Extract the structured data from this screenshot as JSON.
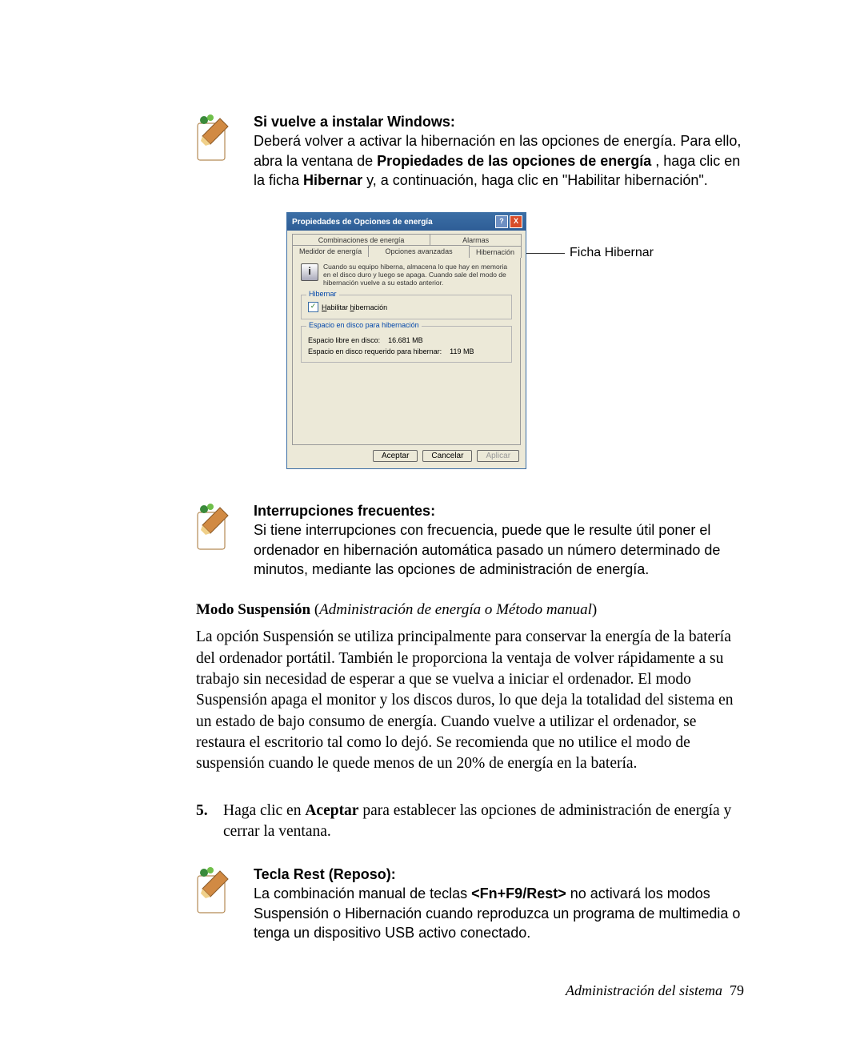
{
  "note1": {
    "title": "Si vuelve a instalar Windows:",
    "t1": "Deberá volver a activar la hibernación en las opciones de energía. Para ello, abra la ventana de ",
    "b1": "Propiedades de las opciones de energía",
    "t2": " , haga clic en la ficha ",
    "b2": "Hibernar",
    "t3": " y, a continuación, haga clic en \"Habilitar hibernación\"."
  },
  "dialog": {
    "title": "Propiedades de Opciones de energía",
    "help_glyph": "?",
    "close_glyph": "X",
    "tabs_row1": {
      "t1": "Combinaciones de energía",
      "t2": "Alarmas"
    },
    "tabs_row2": {
      "t1": "Medidor de energía",
      "t2": "Opciones avanzadas",
      "t3": "Hibernación"
    },
    "info_icon": "i",
    "info": "Cuando su equipo hiberna, almacena lo que hay en memoria en el disco duro y luego se apaga. Cuando sale del modo de hibernación vuelve a su estado anterior.",
    "group1": {
      "legend": "Hibernar",
      "check_glyph": "✓",
      "checkbox": "Habilitar hibernación"
    },
    "group2": {
      "legend": "Espacio en disco para hibernación",
      "free_label": "Espacio libre en disco:",
      "free_value": "16.681 MB",
      "req_label": "Espacio en disco requerido para hibernar:",
      "req_value": "119 MB"
    },
    "accept": "Aceptar",
    "cancel": "Cancelar",
    "apply": "Aplicar"
  },
  "callout": "Ficha Hibernar",
  "note2": {
    "title": "Interrupciones frecuentes:",
    "body": "Si tiene interrupciones con frecuencia, puede que le resulte útil poner el ordenador en hibernación automática pasado un número determinado de minutos, mediante las opciones de administración de energía."
  },
  "heading": {
    "bold": "Modo Suspensión",
    "paren_open": "(",
    "italic": "Administración de energía o Método manual",
    "paren_close": ")"
  },
  "body_para": "La opción Suspensión se utiliza principalmente para conservar la energía de la batería del ordenador portátil. También le proporciona la ventaja de volver rápidamente a su trabajo sin necesidad de esperar a que se vuelva a iniciar el ordenador. El modo Suspensión apaga el monitor y los discos duros, lo que deja la totalidad del sistema en un estado de bajo consumo de energía. Cuando vuelve a utilizar el ordenador, se restaura el escritorio tal como lo dejó. Se recomienda que no utilice el modo de suspensión cuando le quede menos de un 20% de energía en la batería.",
  "step": {
    "num": "5.",
    "t1": "Haga clic en ",
    "b1": "Aceptar",
    "t2": " para establecer las opciones de administración de energía y cerrar la ventana."
  },
  "note3": {
    "title": "Tecla Rest (Reposo):",
    "t1": "La combinación manual de teclas ",
    "b1": "<Fn+F9/Rest>",
    "t2": " no activará los modos Suspensión o Hibernación cuando reproduzca un programa de multimedia o tenga un dispositivo USB activo conectado."
  },
  "footer": {
    "text": "Administración del sistema",
    "page": "79"
  }
}
